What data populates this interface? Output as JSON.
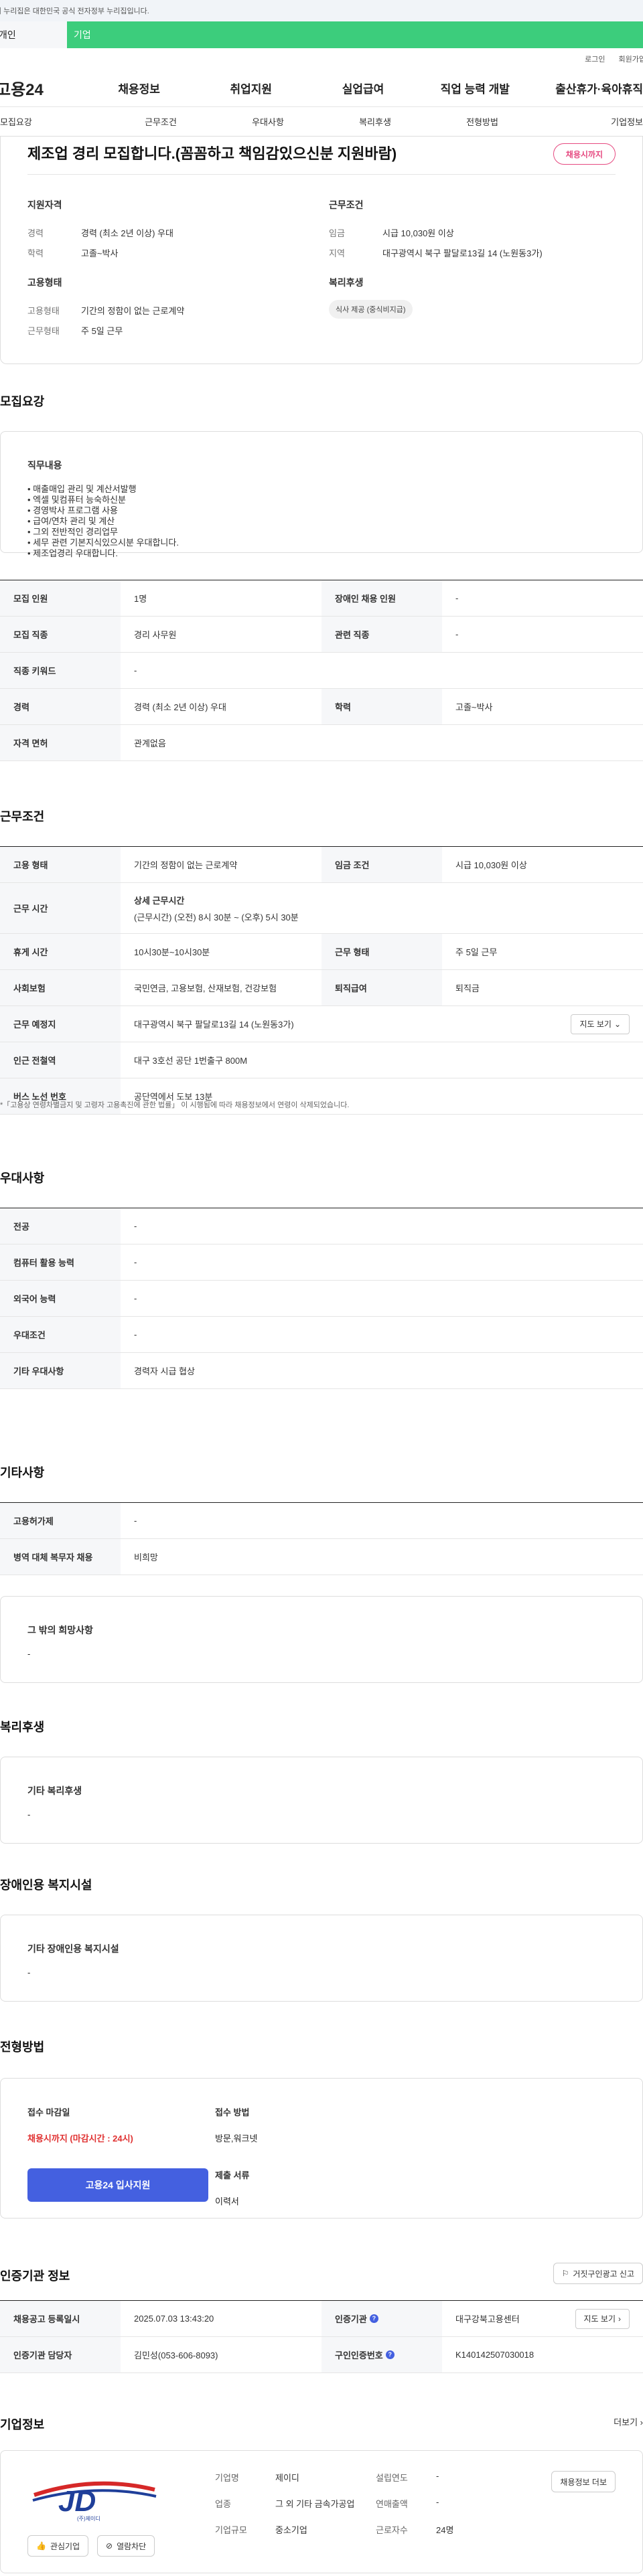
{
  "gov_banner": "이 누리집은 대한민국 공식 전자정부 누리집입니다.",
  "type_tabs": {
    "individual": "개인",
    "company": "기업"
  },
  "util": {
    "login": "로그인",
    "signup": "회원가입"
  },
  "brand": "고용24",
  "gnb": [
    "채용정보",
    "취업지원",
    "실업급여",
    "직업 능력 개발",
    "출산휴가·육아휴직"
  ],
  "subnav": [
    "모집요강",
    "근무조건",
    "우대사항",
    "복리후생",
    "전형방법",
    "기업정보"
  ],
  "job": {
    "title": "제조업 경리 모집합니다.(꼼꼼하고 책임감있으신분 지원바람)",
    "deadline_badge": "채용시까지"
  },
  "summary": {
    "qual_title": "지원자격",
    "career_k": "경력",
    "career_v": "경력 (최소 2년 이상) 우대",
    "edu_k": "학력",
    "edu_v": "고졸~박사",
    "emp_title": "고용형태",
    "emp_k": "고용형태",
    "emp_v": "기간의 정함이 없는 근로계약",
    "form_k": "근무형태",
    "form_v": "주 5일 근무",
    "cond_title": "근무조건",
    "wage_k": "임금",
    "wage_v": "시급 10,030원 이상",
    "region_k": "지역",
    "region_v": "대구광역시 북구 팔달로13길 14 (노원동3가)",
    "welfare_title": "복리후생",
    "welfare_chip": "식사 제공 (중식비지급)"
  },
  "recruit": {
    "section": "모집요강",
    "duty_title": "직무내용",
    "duties": [
      "매출매입 관리 및 계산서발행",
      "엑셀 및컴퓨터 능숙하신분",
      "경영박사 프로그램 사용",
      "급여/연차 관리 및 계산",
      "그외  전반적인 경리업무",
      "세무 관련 기본지식있으시분 우대합니다.",
      "제조업경리 우대합니다."
    ],
    "rows": {
      "headcount_k": "모집 인원",
      "headcount_v": "1명",
      "disabled_k": "장애인 채용 인원",
      "disabled_v": "-",
      "job_k": "모집 직종",
      "job_v": "경리 사무원",
      "related_k": "관련 직종",
      "related_v": "-",
      "keyword_k": "직종 키워드",
      "keyword_v": "-",
      "career_k": "경력",
      "career_v": "경력 (최소 2년 이상) 우대",
      "edu_k": "학력",
      "edu_v": "고졸~박사",
      "license_k": "자격 면허",
      "license_v": "관계없음"
    }
  },
  "work": {
    "section": "근무조건",
    "emp_k": "고용 형태",
    "emp_v": "기간의 정함이 없는 근로계약",
    "wage_k": "임금 조건",
    "wage_v": "시급 10,030원 이상",
    "hours_k": "근무 시간",
    "hours_title": "상세 근무시간",
    "hours_v": "(근무시간) (오전) 8시 30분 ~ (오후) 5시 30분",
    "break_k": "휴게 시간",
    "break_v": "10시30분~10시30분",
    "form_k": "근무 형태",
    "form_v": "주 5일 근무",
    "ins_k": "사회보험",
    "ins_v": "국민연금, 고용보험, 산재보험, 건강보험",
    "retire_k": "퇴직급여",
    "retire_v": "퇴직금",
    "place_k": "근무 예정지",
    "place_v": "대구광역시 북구 팔달로13길 14 (노원동3가)",
    "map_btn": "지도 보기",
    "subway_k": "인근 전철역",
    "subway_v": "대구 3호선 공단 1번출구 800M",
    "bus_k": "버스 노선 번호",
    "bus_v": "공단역에서 도보 13분",
    "note": "*「고용상 연령차별금지 및 고령자 고용촉진에 관한 법률」 이 시행됨에 따라 채용정보에서 연령이 삭제되었습니다."
  },
  "pref": {
    "section": "우대사항",
    "major_k": "전공",
    "major_v": "-",
    "computer_k": "컴퓨터 활용 능력",
    "computer_v": "-",
    "lang_k": "외국어 능력",
    "lang_v": "-",
    "cond_k": "우대조건",
    "cond_v": "-",
    "etc_k": "기타 우대사항",
    "etc_v": "경력자 시급 협상"
  },
  "other": {
    "section": "기타사항",
    "permit_k": "고용허가제",
    "permit_v": "-",
    "military_k": "병역 대체 복무자 채용",
    "military_v": "비희망",
    "hope_title": "그 밖의 희망사항",
    "hope_v": "-"
  },
  "welfare": {
    "section": "복리후생",
    "box_title": "기타 복리후생",
    "box_v": "-"
  },
  "disabled": {
    "section": "장애인용 복지시설",
    "box_title": "기타 장애인용 복지시설",
    "box_v": "-"
  },
  "apply": {
    "section": "전형방법",
    "deadline_k": "접수 마감일",
    "deadline_v": "채용시까지 (마감시간 : 24시)",
    "btn": "고용24 입사지원",
    "method_k": "접수 방법",
    "method_v": "방문,워크넷",
    "docs_k": "제출 서류",
    "docs_v": "이력서"
  },
  "cert": {
    "section": "인증기관 정보",
    "report_btn": "거짓구인광고 신고",
    "date_k": "채용공고 등록일시",
    "date_v": "2025.07.03 13:43:20",
    "org_k": "인증기관",
    "org_v": "대구강북고용센터",
    "map_btn": "지도 보기",
    "manager_k": "인증기관 담당자",
    "manager_v": "김민성(053-606-8093)",
    "no_k": "구인인증번호",
    "no_v": "K140142507030018"
  },
  "company": {
    "section": "기업정보",
    "more": "더보기",
    "logo_text": "JD",
    "logo_sub": "(주)제이디",
    "interest_btn": "관심기업",
    "block_btn": "열람차단",
    "name_k": "기업명",
    "name_v": "제이디",
    "industry_k": "업종",
    "industry_v": "그 외 기타 금속가공업",
    "size_k": "기업규모",
    "size_v": "중소기업",
    "founded_k": "설립연도",
    "founded_v": "-",
    "sales_k": "연매출액",
    "sales_v": "-",
    "employees_k": "근로자수",
    "employees_v": "24명",
    "jobs_btn": "채용정보 더보",
    "brand_blue": "#1f3f9a",
    "brand_red": "#d62828"
  }
}
